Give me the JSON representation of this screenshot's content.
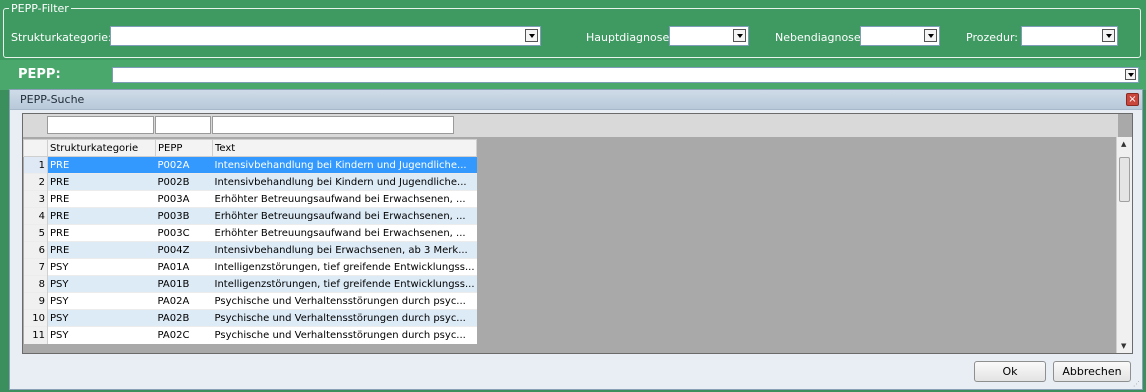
{
  "filter": {
    "legend": "PEPP-Filter",
    "strukturkategorie_label": "Strukturkategorie:",
    "strukturkategorie_value": "",
    "hauptdiagnose_label": "Hauptdiagnose:",
    "hauptdiagnose_value": "",
    "nebendiagnose_label": "Nebendiagnose:",
    "nebendiagnose_value": "",
    "prozedur_label": "Prozedur:",
    "prozedur_value": ""
  },
  "pepp": {
    "label": "PEPP:",
    "value": ""
  },
  "dialog": {
    "title": "PEPP-Suche",
    "columns": [
      "Strukturkategorie",
      "PEPP",
      "Text"
    ],
    "rows": [
      {
        "num": "1",
        "kategorie": "PRE",
        "pepp": "P002A",
        "text": "Intensivbehandlung bei Kindern und Jugendliche...",
        "state": "selected"
      },
      {
        "num": "2",
        "kategorie": "PRE",
        "pepp": "P002B",
        "text": "Intensivbehandlung bei Kindern und Jugendliche...",
        "state": "alt"
      },
      {
        "num": "3",
        "kategorie": "PRE",
        "pepp": "P003A",
        "text": "Erhöhter Betreuungsaufwand bei Erwachsenen, ...",
        "state": "normal"
      },
      {
        "num": "4",
        "kategorie": "PRE",
        "pepp": "P003B",
        "text": "Erhöhter Betreuungsaufwand bei Erwachsenen, ...",
        "state": "alt"
      },
      {
        "num": "5",
        "kategorie": "PRE",
        "pepp": "P003C",
        "text": "Erhöhter Betreuungsaufwand bei Erwachsenen, ...",
        "state": "normal"
      },
      {
        "num": "6",
        "kategorie": "PRE",
        "pepp": "P004Z",
        "text": "Intensivbehandlung bei Erwachsenen, ab 3 Merk...",
        "state": "alt"
      },
      {
        "num": "7",
        "kategorie": "PSY",
        "pepp": "PA01A",
        "text": "Intelligenzstörungen, tief greifende Entwicklungss...",
        "state": "normal"
      },
      {
        "num": "8",
        "kategorie": "PSY",
        "pepp": "PA01B",
        "text": "Intelligenzstörungen, tief greifende Entwicklungss...",
        "state": "alt"
      },
      {
        "num": "9",
        "kategorie": "PSY",
        "pepp": "PA02A",
        "text": "Psychische und Verhaltensstörungen durch psyc...",
        "state": "normal"
      },
      {
        "num": "10",
        "kategorie": "PSY",
        "pepp": "PA02B",
        "text": "Psychische und Verhaltensstörungen durch psyc...",
        "state": "alt"
      },
      {
        "num": "11",
        "kategorie": "PSY",
        "pepp": "PA02C",
        "text": "Psychische und Verhaltensstörungen durch psyc...",
        "state": "normal"
      }
    ],
    "ok_label": "Ok",
    "cancel_label": "Abbrechen"
  }
}
